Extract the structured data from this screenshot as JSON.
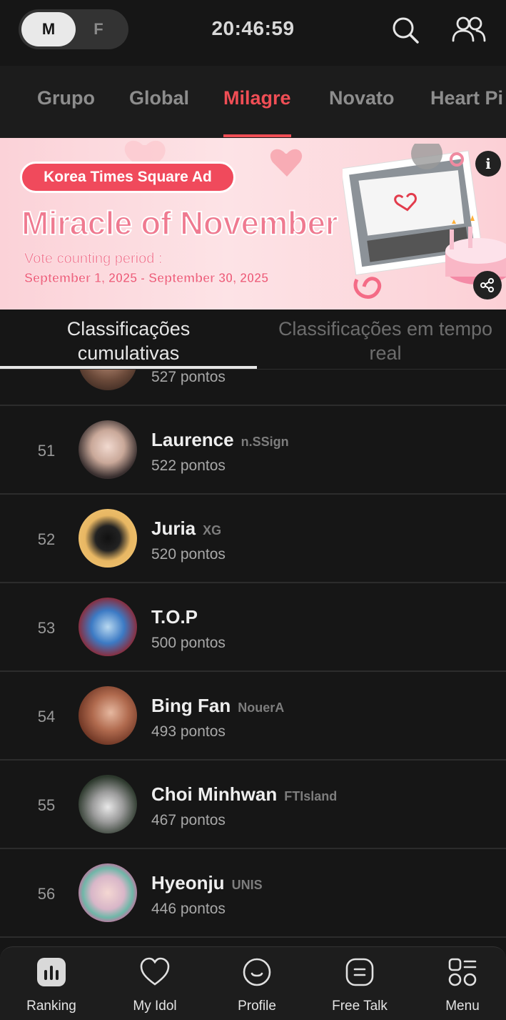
{
  "header": {
    "gender_male": "M",
    "gender_female": "F",
    "clock": "20:46:59",
    "search_icon": "search-icon",
    "friends_icon": "people-icon"
  },
  "category_tabs": {
    "items": [
      "Grupo",
      "Global",
      "Milagre",
      "Novato",
      "Heart Pi"
    ],
    "active": "Milagre",
    "active_color": "#f04e55"
  },
  "banner": {
    "pill": "Korea Times Square Ad",
    "title": "Miracle of November",
    "period_label": "Vote counting period :",
    "period_dates": "September 1, 2025 - September 30, 2025",
    "info_symbol": "i"
  },
  "sub_tabs": {
    "cumulative_line1": "Classificações",
    "cumulative_line2": "cumulativas",
    "realtime_line1": "Classificações em tempo",
    "realtime_line2": "real"
  },
  "ranking": {
    "partial_row_points": "527 pontos",
    "rows": [
      {
        "rank": "51",
        "name": "Laurence",
        "group": "n.SSign",
        "points": "522 pontos"
      },
      {
        "rank": "52",
        "name": "Juria",
        "group": "XG",
        "points": "520 pontos"
      },
      {
        "rank": "53",
        "name": "T.O.P",
        "group": "",
        "points": "500 pontos"
      },
      {
        "rank": "54",
        "name": "Bing Fan",
        "group": "NouerA",
        "points": "493 pontos"
      },
      {
        "rank": "55",
        "name": "Choi Minhwan",
        "group": "FTIsland",
        "points": "467 pontos"
      },
      {
        "rank": "56",
        "name": "Hyeonju",
        "group": "UNIS",
        "points": "446 pontos"
      }
    ]
  },
  "bottom_nav": {
    "ranking": "Ranking",
    "my_idol": "My Idol",
    "profile": "Profile",
    "free_talk": "Free Talk",
    "menu": "Menu"
  }
}
